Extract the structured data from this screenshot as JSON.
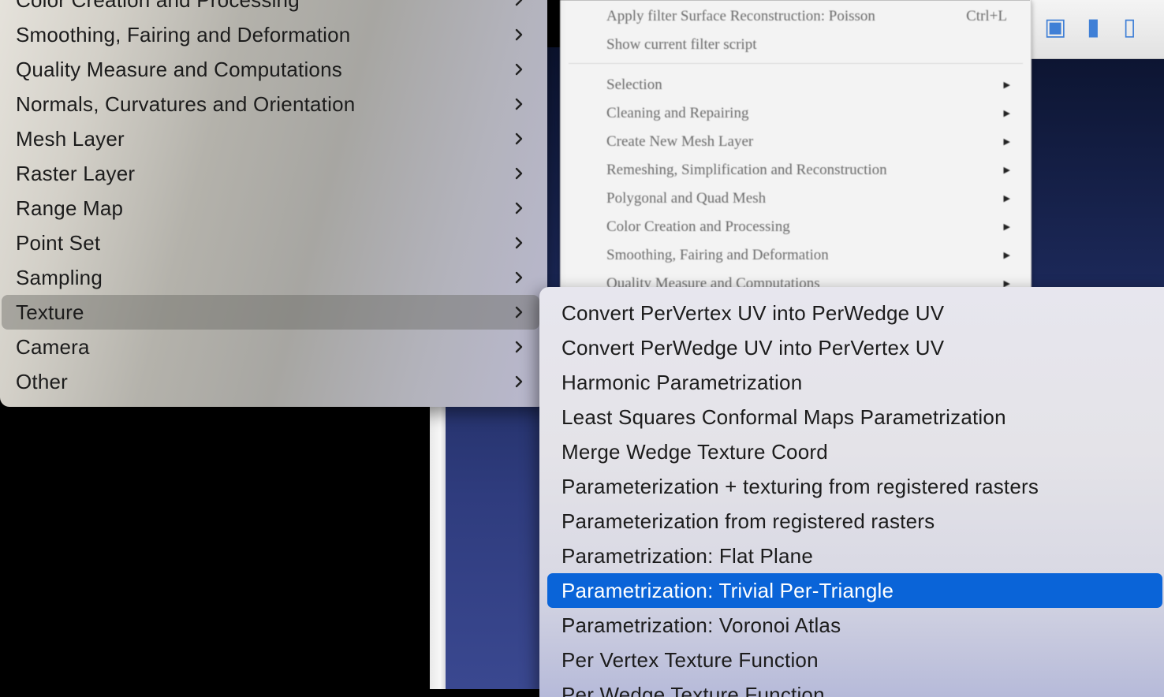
{
  "old_menu": {
    "items": [
      {
        "label": "Apply filter Surface Reconstruction: Poisson",
        "shortcut": "Ctrl+L"
      },
      {
        "label": "Show current filter script"
      },
      {
        "label": "Selection"
      },
      {
        "label": "Cleaning and Repairing"
      },
      {
        "label": "Create New Mesh Layer"
      },
      {
        "label": "Remeshing, Simplification and Reconstruction"
      },
      {
        "label": "Polygonal and Quad Mesh"
      },
      {
        "label": "Color Creation and Processing"
      },
      {
        "label": "Smoothing, Fairing and Deformation"
      },
      {
        "label": "Quality Measure and Computations"
      }
    ]
  },
  "toolbar": {
    "icons": [
      "trash-icon",
      "layer-icon",
      "panel-icon"
    ],
    "accent": "#3f7fd6"
  },
  "main_menu": {
    "items": [
      {
        "label": "Color Creation and Processing"
      },
      {
        "label": "Smoothing, Fairing and Deformation"
      },
      {
        "label": "Quality Measure and Computations"
      },
      {
        "label": "Normals, Curvatures and Orientation"
      },
      {
        "label": "Mesh Layer"
      },
      {
        "label": "Raster Layer"
      },
      {
        "label": "Range Map"
      },
      {
        "label": "Point Set"
      },
      {
        "label": "Sampling"
      },
      {
        "label": "Texture",
        "active": true
      },
      {
        "label": "Camera"
      },
      {
        "label": "Other"
      }
    ]
  },
  "texture_submenu": {
    "items": [
      {
        "label": "Convert PerVertex UV into PerWedge UV"
      },
      {
        "label": "Convert PerWedge UV into PerVertex UV"
      },
      {
        "label": "Harmonic Parametrization"
      },
      {
        "label": "Least Squares Conformal Maps Parametrization"
      },
      {
        "label": "Merge Wedge Texture Coord"
      },
      {
        "label": "Parameterization + texturing from registered rasters"
      },
      {
        "label": "Parameterization from registered rasters"
      },
      {
        "label": "Parametrization: Flat Plane"
      },
      {
        "label": "Parametrization: Trivial Per-Triangle",
        "selected": true
      },
      {
        "label": "Parametrization: Voronoi Atlas"
      },
      {
        "label": "Per Vertex Texture Function"
      },
      {
        "label": "Per Wedge Texture Function"
      }
    ],
    "selection_color": "#0a64d8"
  }
}
